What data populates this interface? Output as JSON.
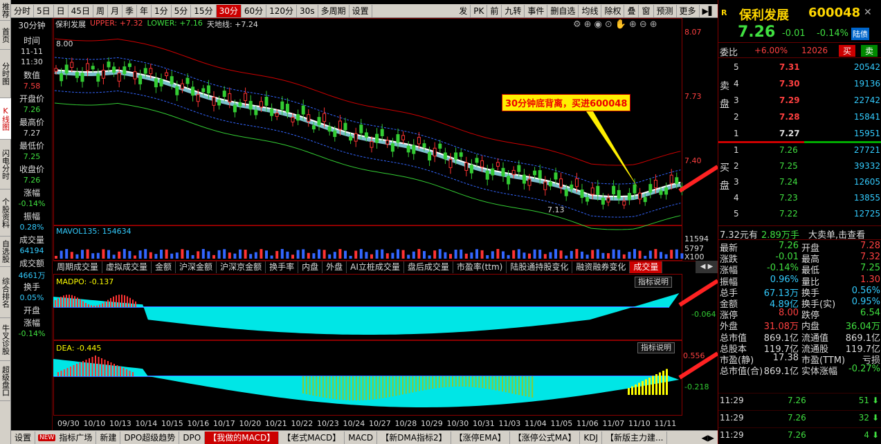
{
  "left_nav": [
    "推荐",
    "首页",
    "分时图",
    "K线图",
    "闪电分时",
    "个股资料",
    "自选股",
    "综合排名",
    "牛叉诊股",
    "超级盘口"
  ],
  "left_nav_active": 3,
  "toolbar": {
    "left_items": [
      "分时",
      "5日",
      "日",
      "45日",
      "周",
      "月",
      "季",
      "年",
      "1分",
      "5分",
      "15分",
      "30分",
      "60分",
      "120分",
      "30s",
      "多周期",
      "设置"
    ],
    "active": "30分",
    "right_items": [
      "发",
      "PK",
      "前",
      "九转",
      "事件",
      "删自选",
      "均线",
      "除权",
      "叠",
      "窗",
      "预测",
      "更多"
    ]
  },
  "info": {
    "period": "30分钟",
    "time_label": "时间",
    "time_date": "11-11",
    "time_time": "11:30",
    "value_label": "数值",
    "value": "7.58",
    "open_label": "开盘价",
    "open": "7.26",
    "high_label": "最高价",
    "high": "7.27",
    "low_label": "最低价",
    "low": "7.25",
    "close_label": "收盘价",
    "close": "7.26",
    "chg_label": "涨幅",
    "chg": "-0.14%",
    "amp_label": "振幅",
    "amp": "0.28%",
    "vol_label": "成交量",
    "vol": "64194",
    "amt_label": "成交额",
    "amt": "4661万",
    "turn_label": "换手",
    "turn": "0.05%",
    "ochg_label1": "开盘",
    "ochg_label2": "涨幅",
    "ochg": "-0.14%"
  },
  "chart_header": {
    "name": "保利发展",
    "upper": "UPPER: +7.32",
    "lower": "LOWER: +7.16",
    "tdx": "天地线: +7.24",
    "low_marker": "8.00",
    "low_price": "7.13"
  },
  "price_axis": [
    "8.07",
    "7.73",
    "7.40"
  ],
  "annotation": "30分钟底背离，买进600048",
  "volume_pane": {
    "label": "MAVOL135: 154634",
    "axis": [
      "11594",
      "5797",
      "X100"
    ]
  },
  "indicator_tabs": [
    "周期成交量",
    "虚拟成交量",
    "金额",
    "沪深金额",
    "沪深京金额",
    "换手率",
    "内盘",
    "外盘",
    "AI立桩成交量",
    "盘后成交量",
    "市盈率(ttm)",
    "陆股通持股变化",
    "融资融券变化",
    "成交量"
  ],
  "indicator_tabs_active": "成交量",
  "madpo": {
    "label": "MADPO: -0.137",
    "axis": "-0.064",
    "help": "指标说明"
  },
  "macd": {
    "label": "DEA: -0.445",
    "axis_top": "0.556",
    "axis_bot": "-0.218",
    "help": "指标说明"
  },
  "date_axis": [
    "09/30",
    "10/10",
    "10/13",
    "10/14",
    "10/15",
    "10/16",
    "10/17",
    "10/20",
    "10/21",
    "10/22",
    "10/23",
    "10/24",
    "10/27",
    "10/28",
    "10/29",
    "10/30",
    "10/31",
    "11/03",
    "11/04",
    "11/05",
    "11/06",
    "11/07",
    "11/10",
    "11/11"
  ],
  "bottom_tabs": [
    "设置",
    "指标广场",
    "新建",
    "DPO超级趋势",
    "DPO",
    "【我做的MACD】",
    "【老式MACD】",
    "MACD",
    "【新DMA指标2】",
    "【涨停EMA】",
    "【涨停公式MA】",
    "KDJ",
    "【新版主力建..."
  ],
  "bottom_active": "【我做的MACD】",
  "new_badge": "NEW",
  "quote": {
    "letter": "R",
    "name": "保利发展",
    "code": "600048",
    "price": "7.26",
    "change": "-0.01",
    "pct": "-0.14%",
    "tag": "陆债",
    "wb_label": "委比",
    "wb": "+6.00%",
    "wc": "12026",
    "buy": "买",
    "sell": "卖",
    "sell_label": "卖盘",
    "buy_label": "买盘",
    "asks": [
      [
        "5",
        "7.31",
        "20542"
      ],
      [
        "4",
        "7.30",
        "19136"
      ],
      [
        "3",
        "7.29",
        "22742"
      ],
      [
        "2",
        "7.28",
        "15841"
      ],
      [
        "1",
        "7.27",
        "15951"
      ]
    ],
    "bids": [
      [
        "1",
        "7.26",
        "27721"
      ],
      [
        "2",
        "7.25",
        "39332"
      ],
      [
        "3",
        "7.24",
        "12605"
      ],
      [
        "4",
        "7.23",
        "13855"
      ],
      [
        "5",
        "7.22",
        "12725"
      ]
    ],
    "big_order": "7.32元有",
    "big_order_hand": "2.89万手",
    "big_order_link": "大卖单,击查看",
    "stats": [
      [
        "最新",
        "7.26",
        "开盘",
        "7.28"
      ],
      [
        "涨跌",
        "-0.01",
        "最高",
        "7.32"
      ],
      [
        "涨幅",
        "-0.14%",
        "最低",
        "7.25"
      ],
      [
        "振幅",
        "0.96%",
        "量比",
        "1.30"
      ],
      [
        "总手",
        "67.13万",
        "换手",
        "0.56%"
      ],
      [
        "金额",
        "4.89亿",
        "换手(实)",
        "0.95%"
      ],
      [
        "涨停",
        "8.00",
        "跌停",
        "6.54"
      ],
      [
        "外盘",
        "31.08万",
        "内盘",
        "36.04万"
      ],
      [
        "总市值",
        "869.1亿",
        "流通值",
        "869.1亿"
      ],
      [
        "总股本",
        "119.7亿",
        "流通股",
        "119.7亿"
      ],
      [
        "市盈(静)",
        "17.38",
        "市盈(TTM)",
        "亏损"
      ],
      [
        "总市值(合)",
        "869.1亿",
        "实体涨幅",
        "-0.27%"
      ]
    ],
    "ticks": [
      [
        "11:29",
        "7.26",
        "51"
      ],
      [
        "11:29",
        "7.26",
        "32"
      ],
      [
        "11:29",
        "7.26",
        "4"
      ]
    ]
  }
}
